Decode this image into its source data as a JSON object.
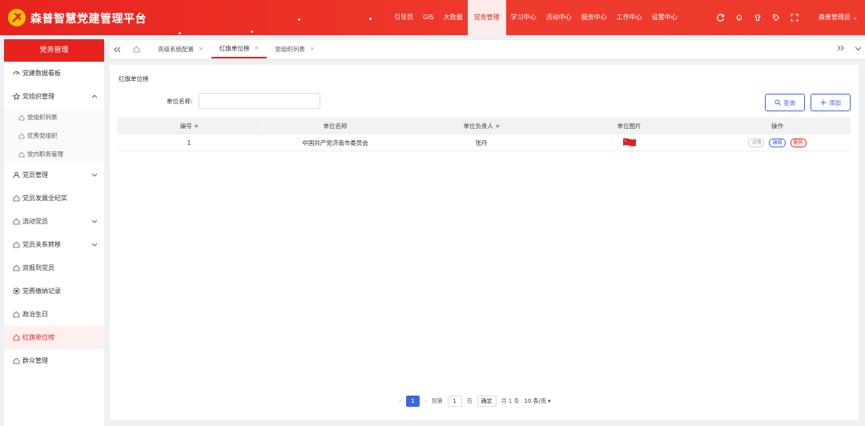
{
  "header": {
    "brand": "森普智慧党建管理平台",
    "nav": [
      "引导页",
      "GIS",
      "大数据",
      "党务管理",
      "学习中心",
      "活动中心",
      "服务中心",
      "工作中心",
      "设置中心"
    ],
    "active_nav": "党务管理",
    "user": "森普管理员",
    "icons": [
      "refresh-icon",
      "bell-icon",
      "skin-icon",
      "tag-icon",
      "fullscreen-icon"
    ],
    "accent": "#e8231e"
  },
  "sidebar": {
    "title": "党务管理",
    "items": [
      {
        "label": "党建数据看板",
        "icon": "dashboard-icon"
      },
      {
        "label": "党组织管理",
        "icon": "star-icon",
        "expanded": true
      },
      {
        "label": "党组织列表",
        "sub": true
      },
      {
        "label": "优秀党组织",
        "sub": true
      },
      {
        "label": "党内职务管理",
        "sub": true
      },
      {
        "label": "党员管理",
        "icon": "user-icon",
        "collapsible": true
      },
      {
        "label": "党员发展全纪实",
        "icon": "house-icon"
      },
      {
        "label": "流动党员",
        "icon": "house-icon",
        "collapsible": true
      },
      {
        "label": "党员关系转移",
        "icon": "house-icon",
        "collapsible": true
      },
      {
        "label": "双报到党员",
        "icon": "house-icon"
      },
      {
        "label": "党费缴纳记录",
        "icon": "target-icon"
      },
      {
        "label": "政治生日",
        "icon": "house-icon"
      },
      {
        "label": "红旗单位榜",
        "icon": "house-icon",
        "active": true
      },
      {
        "label": "群众管理",
        "icon": "house-icon"
      }
    ]
  },
  "tabs": [
    {
      "label": "高级系统配置",
      "active": false
    },
    {
      "label": "红旗单位榜",
      "active": true
    },
    {
      "label": "党组织列表",
      "active": false
    }
  ],
  "main": {
    "page_title": "红旗单位榜",
    "search_label": "单位名称:",
    "search_placeholder": "",
    "search_button": "查询",
    "add_button": "添加",
    "columns": [
      "编号",
      "单位名称",
      "单位负责人",
      "单位图片",
      "操作"
    ],
    "rows": [
      {
        "id": "1",
        "name": "中国共产党济南市委员会",
        "leader": "张丹",
        "actions": [
          "详情",
          "编辑",
          "删除"
        ]
      }
    ]
  },
  "pager": {
    "current_page": "1",
    "goto_label": "到第",
    "goto_value": "1",
    "page_suffix": "页",
    "confirm": "确定",
    "total": "共 1 条",
    "page_size": "10 条/页"
  }
}
